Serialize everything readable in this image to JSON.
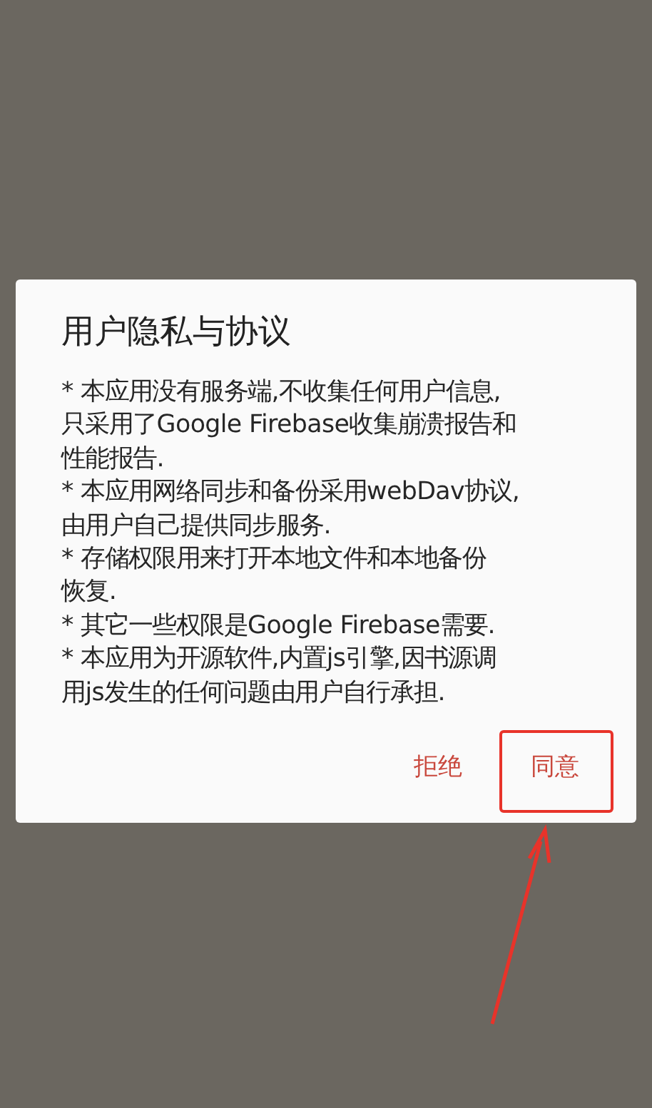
{
  "dialog": {
    "title": "用户隐私与协议",
    "items": [
      [
        "* 本应用没有服务端,不收集任何用户信息,",
        "只采用了Google Firebase收集崩溃报告和",
        "性能报告."
      ],
      [
        "* 本应用网络同步和备份采用webDav协议,",
        "由用户自己提供同步服务."
      ],
      [
        "* 存储权限用来打开本地文件和本地备份",
        "恢复."
      ],
      [
        "* 其它一些权限是Google Firebase需要."
      ],
      [
        "* 本应用为开源软件,内置js引擎,因书源调",
        "用js发生的任何问题由用户自行承担."
      ]
    ],
    "buttons": [
      {
        "label": "拒绝",
        "highlighted": false
      },
      {
        "label": "同意",
        "highlighted": true
      }
    ]
  }
}
